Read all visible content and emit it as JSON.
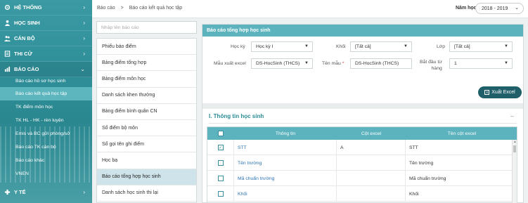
{
  "sidebar": {
    "menu": [
      {
        "label": "HỆ THỐNG",
        "icon": "gear-icon"
      },
      {
        "label": "HỌC SINH",
        "icon": "user-icon"
      },
      {
        "label": "CÁN BỘ",
        "icon": "users-icon"
      },
      {
        "label": "THI CỬ",
        "icon": "exam-icon"
      },
      {
        "label": "BÁO CÁO",
        "icon": "report-icon"
      }
    ],
    "submenu": [
      "Báo cáo hồ sơ học sinh",
      "Báo cáo kết quả học tập",
      "TK điểm môn học",
      "TK HL - HK - rèn luyện",
      "Emis và BC gửi phòng/sở",
      "Báo cáo TK cán bộ",
      "Báo cáo khác",
      "VNEN"
    ],
    "bottom_menu": {
      "label": "Y TẾ",
      "icon": "medical-icon"
    }
  },
  "topbar": {
    "breadcrumb": [
      "Báo cáo",
      ">",
      "Báo cáo kết quả học tập"
    ],
    "year_label": "Năm học",
    "year_value": "2018 - 2019"
  },
  "report_list": {
    "search_placeholder": "Nhập tên báo cáo",
    "items": [
      "Phiếu báo điểm",
      "Bảng điểm tổng hợp",
      "Bảng điểm môn học",
      "Danh sách khen thưởng",
      "Bảng điểm bình quân CN",
      "Sổ điểm bộ môn",
      "Sổ gọi tên ghi điểm",
      "Học bạ",
      "Báo cáo tổng hợp học sinh",
      "Danh sách học sinh thi lại"
    ],
    "active_index": 8
  },
  "panel": {
    "title": "Báo cáo tổng hợp học sinh",
    "filters": {
      "hoc_ky_label": "Học kỳ",
      "hoc_ky_value": "Học kỳ I",
      "khoi_label": "Khối",
      "khoi_value": "[Tất cả]",
      "lop_label": "Lớp",
      "lop_value": "[Tất cả]",
      "mau_xuat_label": "Mẫu xuất excel",
      "mau_xuat_value": "DS-HocSinh (THCS)",
      "ten_mau_label": "Tên mẫu",
      "ten_mau_required": "*",
      "ten_mau_value": "DS-HocSinh (THCS)",
      "bat_dau_label_1": "Bắt đầu từ",
      "bat_dau_label_2": "hàng",
      "bat_dau_value": "1"
    },
    "export_label": "Xuất Excel",
    "section_title": "I. Thông tin học sinh",
    "table": {
      "headers": [
        "",
        "Thông tin",
        "Cột excel",
        "Tên cột excel"
      ],
      "rows": [
        {
          "checked": true,
          "info": "STT",
          "col": "A",
          "name": "STT"
        },
        {
          "checked": false,
          "info": "Tên trường",
          "col": "",
          "name": "Tên trường"
        },
        {
          "checked": false,
          "info": "Mã chuẩn trường",
          "col": "",
          "name": "Mã chuẩn trường"
        },
        {
          "checked": false,
          "info": "Khối",
          "col": "",
          "name": "Khối"
        }
      ]
    }
  }
}
